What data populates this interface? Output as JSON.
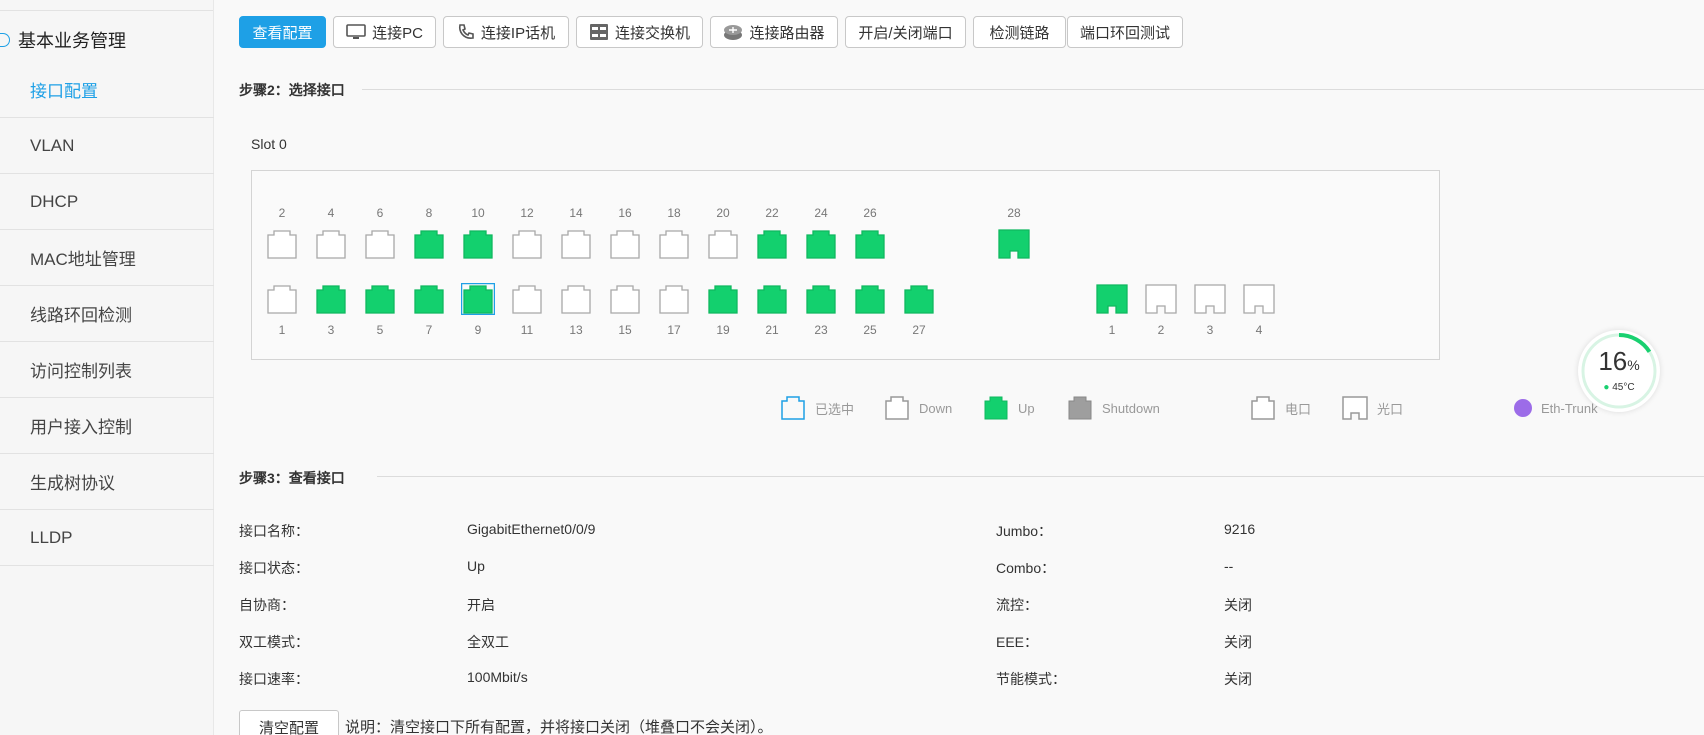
{
  "sidebar": {
    "group": "基本业务管理",
    "items": [
      "接口配置",
      "VLAN",
      "DHCP",
      "MAC地址管理",
      "线路环回检测",
      "访问控制列表",
      "用户接入控制",
      "生成树协议",
      "LLDP"
    ]
  },
  "toolbar": {
    "view_config": "查看配置",
    "connect_pc": "连接PC",
    "connect_ipphone": "连接IP话机",
    "connect_switch": "连接交换机",
    "connect_router": "连接路由器",
    "toggle_port": "开启/关闭端口",
    "detect_link": "检测链路",
    "loopback_test": "端口环回测试"
  },
  "step2": {
    "title": "步骤2：选择接口",
    "slot": "Slot 0"
  },
  "ports": {
    "top": [
      {
        "num": "2",
        "state": "down"
      },
      {
        "num": "4",
        "state": "down"
      },
      {
        "num": "6",
        "state": "down"
      },
      {
        "num": "8",
        "state": "up"
      },
      {
        "num": "10",
        "state": "up"
      },
      {
        "num": "12",
        "state": "down"
      },
      {
        "num": "14",
        "state": "down"
      },
      {
        "num": "16",
        "state": "down"
      },
      {
        "num": "18",
        "state": "down"
      },
      {
        "num": "20",
        "state": "down"
      },
      {
        "num": "22",
        "state": "up"
      },
      {
        "num": "24",
        "state": "up"
      },
      {
        "num": "26",
        "state": "up"
      }
    ],
    "top_extra": {
      "num": "28",
      "state": "up-fiber"
    },
    "bottom": [
      {
        "num": "1",
        "state": "down"
      },
      {
        "num": "3",
        "state": "up"
      },
      {
        "num": "5",
        "state": "up"
      },
      {
        "num": "7",
        "state": "up"
      },
      {
        "num": "9",
        "state": "selected-up"
      },
      {
        "num": "11",
        "state": "down"
      },
      {
        "num": "13",
        "state": "down"
      },
      {
        "num": "15",
        "state": "down"
      },
      {
        "num": "17",
        "state": "down"
      },
      {
        "num": "19",
        "state": "up"
      },
      {
        "num": "21",
        "state": "up"
      },
      {
        "num": "23",
        "state": "up"
      },
      {
        "num": "25",
        "state": "up"
      },
      {
        "num": "27",
        "state": "up"
      }
    ],
    "fiber": [
      {
        "num": "1",
        "state": "up"
      },
      {
        "num": "2",
        "state": "down"
      },
      {
        "num": "3",
        "state": "down"
      },
      {
        "num": "4",
        "state": "down"
      }
    ]
  },
  "legend": {
    "selected": "已选中",
    "down": "Down",
    "up": "Up",
    "shutdown": "Shutdown",
    "electric": "电口",
    "optical": "光口",
    "eth_trunk": "Eth-Trunk"
  },
  "colors": {
    "accent": "#1ea0e6",
    "up": "#13d06e",
    "shutdown": "#9e9e9e",
    "trunk": "#9c6ce8"
  },
  "gauge": {
    "percent": "16",
    "percent_sign": "%",
    "temperature": "45°C"
  },
  "step3": {
    "title": "步骤3：查看接口",
    "left": [
      {
        "label": "接口名称：",
        "value": "GigabitEthernet0/0/9"
      },
      {
        "label": "接口状态：",
        "value": "Up"
      },
      {
        "label": "自协商：",
        "value": "开启"
      },
      {
        "label": "双工模式：",
        "value": "全双工"
      },
      {
        "label": "接口速率：",
        "value": "100Mbit/s"
      }
    ],
    "right": [
      {
        "label": "Jumbo：",
        "value": "9216"
      },
      {
        "label": "Combo：",
        "value": "--"
      },
      {
        "label": "流控：",
        "value": "关闭"
      },
      {
        "label": "EEE：",
        "value": "关闭"
      },
      {
        "label": "节能模式：",
        "value": "关闭"
      }
    ]
  },
  "footer": {
    "clear_button": "清空配置",
    "note": "说明：清空接口下所有配置，并将接口关闭（堆叠口不会关闭）。"
  }
}
